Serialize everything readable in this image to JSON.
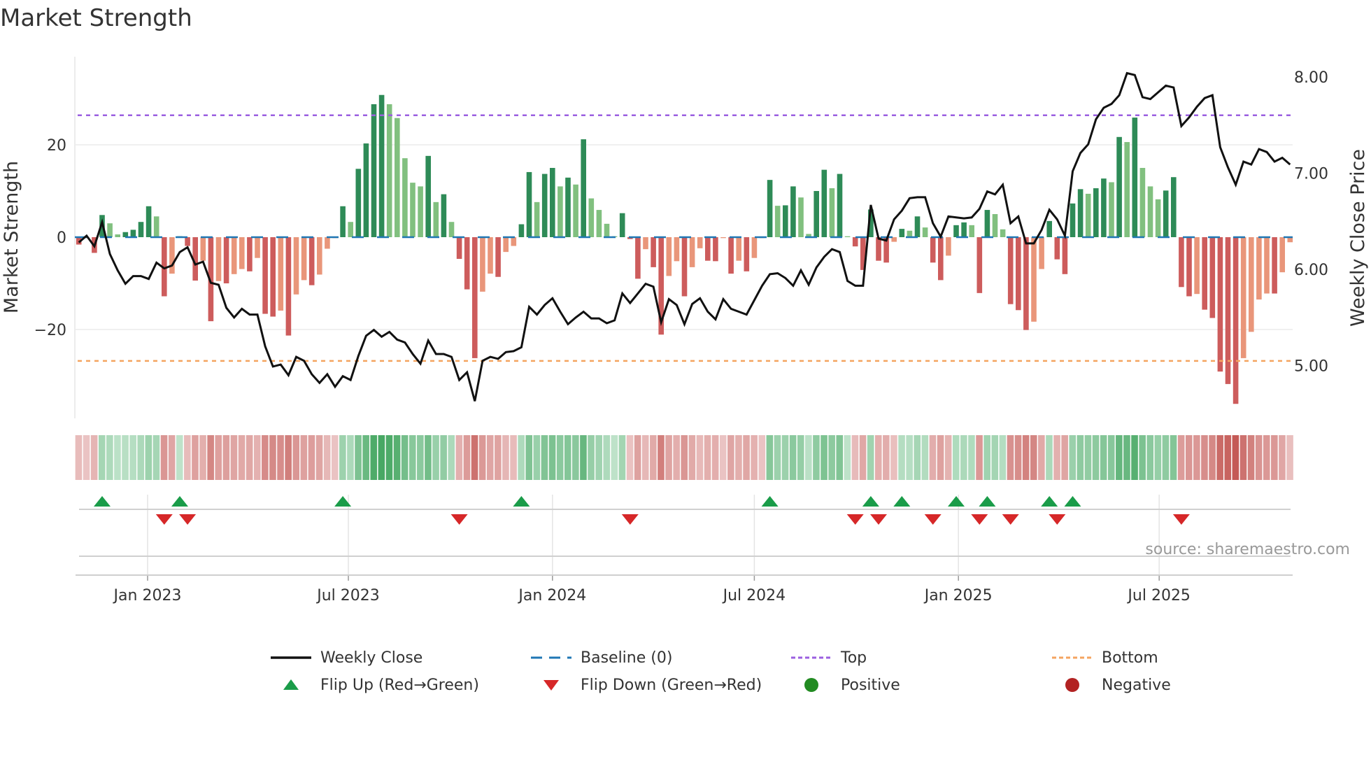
{
  "chart_data": {
    "type": "bar",
    "title": "Market Strength",
    "ylabel": "Market Strength",
    "y2label": "Weekly Close Price",
    "frequency": "weekly",
    "start_date": "2022-10-31",
    "ylim": [
      -39,
      39.5
    ],
    "y2lim": [
      4.55,
      8.21
    ],
    "yticks": [
      {
        "v": 20,
        "label": "20"
      },
      {
        "v": 0,
        "label": "0"
      },
      {
        "v": -20,
        "label": "−20"
      }
    ],
    "y2ticks": [
      {
        "v": 8,
        "label": "8.00"
      },
      {
        "v": 7,
        "label": "7.00"
      },
      {
        "v": 6,
        "label": "6.00"
      },
      {
        "v": 5,
        "label": "5.00"
      }
    ],
    "xticks": [
      {
        "date": "2023-01-01",
        "label": "Jan 2023"
      },
      {
        "date": "2023-07-01",
        "label": "Jul 2023"
      },
      {
        "date": "2024-01-01",
        "label": "Jan 2024"
      },
      {
        "date": "2024-07-01",
        "label": "Jul 2024"
      },
      {
        "date": "2025-01-01",
        "label": "Jan 2025"
      },
      {
        "date": "2025-07-01",
        "label": "Jul 2025"
      }
    ],
    "top_level": 26.4,
    "bottom_level": -26.8,
    "baseline": 0,
    "grid": true,
    "legend_placement": "bottom-center",
    "strength": [
      -1.6,
      -0.2,
      -3.4,
      4.8,
      3.0,
      0.6,
      1.1,
      1.6,
      3.3,
      6.7,
      4.5,
      -12.8,
      -7.9,
      0.2,
      -1.9,
      -9.4,
      -5.1,
      -18.2,
      -9.5,
      -10.0,
      -8.0,
      -6.9,
      -7.4,
      -4.5,
      -16.6,
      -17.2,
      -15.9,
      -21.3,
      -12.4,
      -9.3,
      -10.4,
      -8.1,
      -2.5,
      -0.2,
      6.7,
      3.3,
      14.8,
      20.3,
      28.8,
      30.8,
      28.8,
      25.8,
      17.1,
      11.8,
      11.0,
      17.6,
      7.6,
      9.3,
      3.3,
      -4.7,
      -11.3,
      -26.2,
      -11.8,
      -7.9,
      -8.6,
      -3.2,
      -1.9,
      2.8,
      14.1,
      7.6,
      13.7,
      15.0,
      11.0,
      12.9,
      11.4,
      21.2,
      8.4,
      5.9,
      2.9,
      0.2,
      5.2,
      -0.4,
      -9.0,
      -2.6,
      -6.5,
      -21.1,
      -8.4,
      -5.2,
      -12.8,
      -6.5,
      -2.4,
      -5.1,
      -5.2,
      -0.2,
      -7.9,
      -5.1,
      -7.4,
      -4.5,
      -0.2,
      12.4,
      6.8,
      6.9,
      11.0,
      8.6,
      0.7,
      10.0,
      14.6,
      10.6,
      13.7,
      0.2,
      -2.0,
      -7.1,
      6.0,
      -5.1,
      -5.5,
      -1.0,
      1.8,
      1.4,
      4.5,
      2.1,
      -5.5,
      -9.3,
      -4.0,
      2.6,
      3.2,
      2.6,
      -12.1,
      5.9,
      5.0,
      1.7,
      -14.5,
      -15.8,
      -20.1,
      -18.3,
      -6.9,
      3.5,
      -4.8,
      -8.0,
      7.3,
      10.4,
      9.4,
      10.6,
      12.7,
      11.9,
      21.7,
      20.6,
      25.9,
      15.0,
      11.0,
      8.2,
      10.1,
      13.0,
      -10.8,
      -12.8,
      -12.3,
      -15.7,
      -17.5,
      -29.1,
      -31.8,
      -36.1,
      -26.2,
      -20.5,
      -13.5,
      -12.2,
      -12.2,
      -7.6,
      -1.1
    ],
    "weekly_close": [
      6.28,
      6.35,
      6.24,
      6.49,
      6.16,
      5.99,
      5.85,
      5.93,
      5.93,
      5.9,
      6.07,
      6.01,
      6.04,
      6.18,
      6.23,
      6.05,
      6.08,
      5.86,
      5.84,
      5.6,
      5.5,
      5.59,
      5.53,
      5.53,
      5.2,
      4.99,
      5.01,
      4.9,
      5.09,
      5.05,
      4.91,
      4.82,
      4.91,
      4.78,
      4.89,
      4.85,
      5.1,
      5.31,
      5.37,
      5.3,
      5.35,
      5.27,
      5.24,
      5.12,
      5.02,
      5.26,
      5.12,
      5.12,
      5.09,
      4.85,
      4.93,
      4.63,
      5.05,
      5.09,
      5.07,
      5.14,
      5.15,
      5.19,
      5.61,
      5.53,
      5.63,
      5.7,
      5.56,
      5.43,
      5.5,
      5.56,
      5.49,
      5.49,
      5.44,
      5.47,
      5.75,
      5.65,
      5.75,
      5.85,
      5.82,
      5.45,
      5.69,
      5.63,
      5.43,
      5.64,
      5.7,
      5.56,
      5.48,
      5.69,
      5.59,
      5.56,
      5.53,
      5.68,
      5.83,
      5.95,
      5.96,
      5.91,
      5.83,
      5.99,
      5.84,
      6.02,
      6.13,
      6.21,
      6.18,
      5.88,
      5.83,
      5.83,
      6.67,
      6.32,
      6.3,
      6.52,
      6.61,
      6.74,
      6.75,
      6.75,
      6.48,
      6.34,
      6.55,
      6.54,
      6.53,
      6.54,
      6.63,
      6.81,
      6.78,
      6.88,
      6.48,
      6.55,
      6.27,
      6.27,
      6.41,
      6.62,
      6.52,
      6.35,
      7.02,
      7.21,
      7.3,
      7.56,
      7.68,
      7.72,
      7.81,
      8.04,
      8.02,
      7.79,
      7.77,
      7.84,
      7.91,
      7.89,
      7.49,
      7.58,
      7.69,
      7.78,
      7.81,
      7.27,
      7.06,
      6.88,
      7.12,
      7.09,
      7.25,
      7.22,
      7.12,
      7.16,
      7.09
    ],
    "source_note": "source: sharemaestro.com"
  },
  "colors": {
    "green_strong": "#2e8b57",
    "green_weak": "#81c07f",
    "red_strong": "#cd5c5c",
    "red_weak": "#e9967a",
    "baseline": "#1f77b4",
    "top": "#9b5fe0",
    "bottom": "#f4a460",
    "flip_up": "#1a9c49",
    "flip_down": "#d62728",
    "positive": "#228b22",
    "negative": "#b22222",
    "close": "#111111"
  },
  "legend": {
    "weekly_close": "Weekly Close",
    "baseline": "Baseline (0)",
    "top": "Top",
    "bottom": "Bottom",
    "flip_up": "Flip Up (Red→Green)",
    "flip_down": "Flip Down (Green→Red)",
    "positive": "Positive",
    "negative": "Negative"
  }
}
